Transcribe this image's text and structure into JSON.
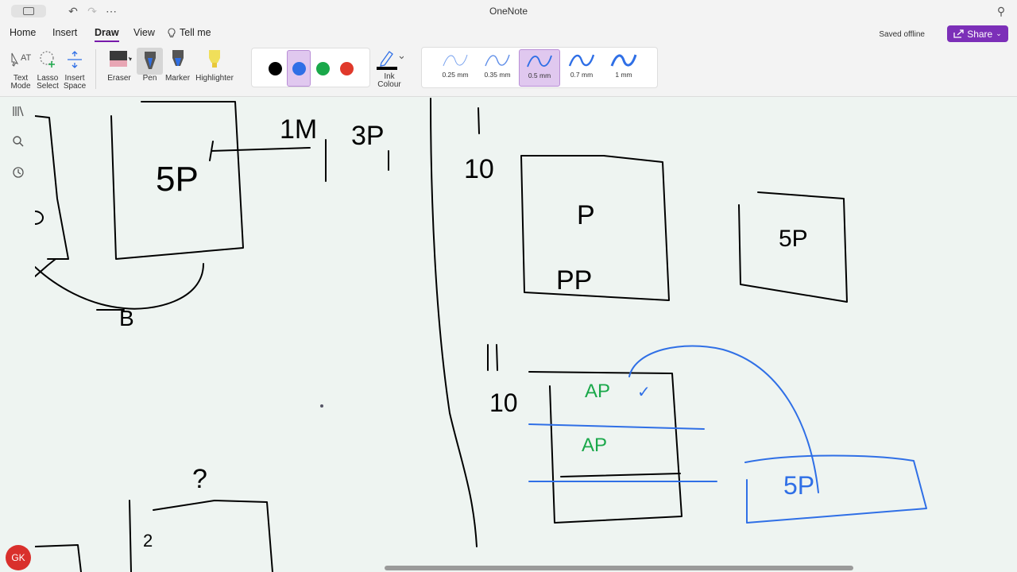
{
  "app": {
    "title": "OneNote"
  },
  "tabs": [
    "Home",
    "Insert",
    "Draw",
    "View"
  ],
  "tell_me": "Tell me",
  "status": {
    "saved": "Saved offline"
  },
  "share": {
    "label": "Share"
  },
  "tools": {
    "text_mode": [
      "Text",
      "Mode"
    ],
    "lasso": [
      "Lasso",
      "Select"
    ],
    "insert_space": [
      "Insert",
      "Space"
    ],
    "eraser": "Eraser",
    "pen": "Pen",
    "marker": "Marker",
    "highlighter": "Highlighter",
    "ink_colour": [
      "Ink",
      "Colour"
    ]
  },
  "colors": {
    "black": "#000000",
    "blue": "#2f6fe6",
    "green": "#1aa84a",
    "red": "#e0392b",
    "accent": "#7c2fb8"
  },
  "widths": [
    "0.25 mm",
    "0.35 mm",
    "0.5 mm",
    "0.7 mm",
    "1 mm"
  ],
  "user": {
    "initials": "GK"
  },
  "ink_text": {
    "t1m": "1M",
    "t3p": "3P",
    "t5p": "5P",
    "t2": "2",
    "tB": "B",
    "tq": "?",
    "t1": "1",
    "t10": "10",
    "tP": "P",
    "tPP": "PP",
    "t5p2": "5P",
    "t11": "11",
    "t10b": "10",
    "tAP": "AP",
    "tAP2": "AP",
    "tv": "✓",
    "t5p3": "5P"
  }
}
